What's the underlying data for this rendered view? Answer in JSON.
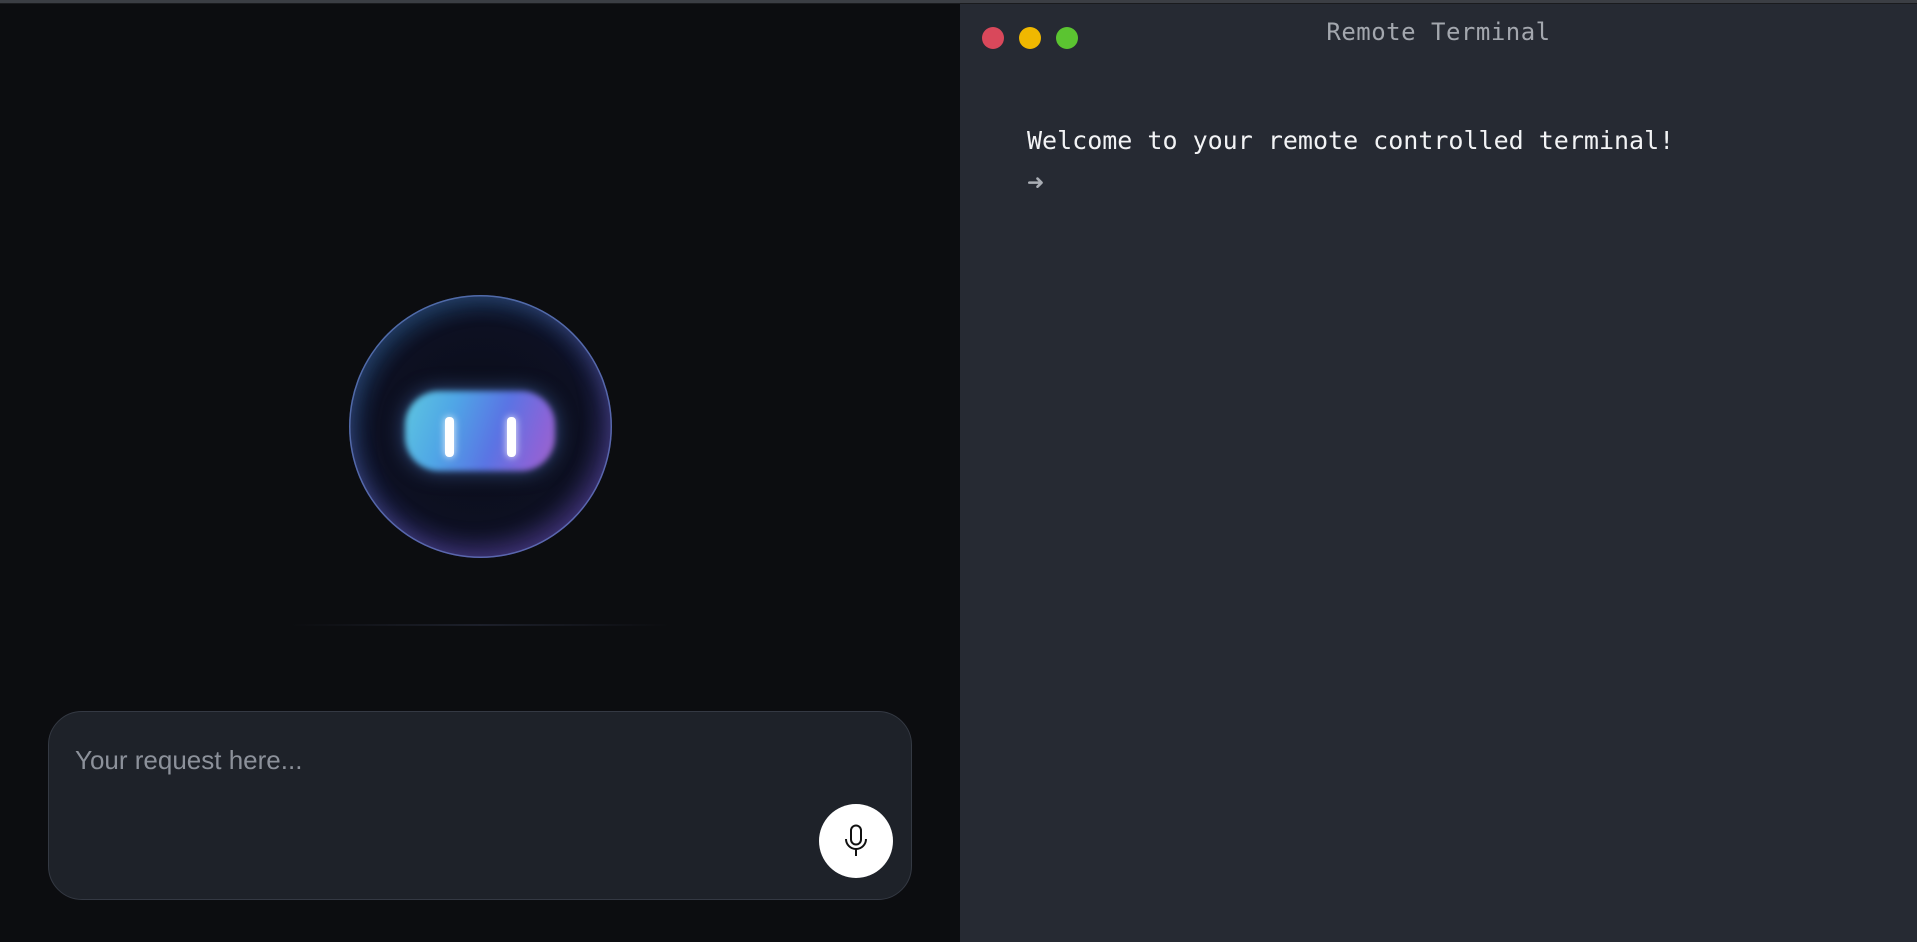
{
  "assistant": {
    "request_placeholder": "Your request here...",
    "mic_icon": "microphone-icon",
    "orb_icon": "assistant-orb-icon"
  },
  "terminal": {
    "title": "Remote Terminal",
    "welcome_line": "Welcome to your remote controlled terminal!",
    "prompt_symbol": "➜",
    "window_controls": [
      {
        "name": "close",
        "color": "#d9485b"
      },
      {
        "name": "minimize",
        "color": "#f0b800"
      },
      {
        "name": "maximize",
        "color": "#5bc431"
      }
    ]
  },
  "colors": {
    "left_background": "#0c0d10",
    "terminal_background": "#262a33",
    "input_background": "#1e2229"
  }
}
